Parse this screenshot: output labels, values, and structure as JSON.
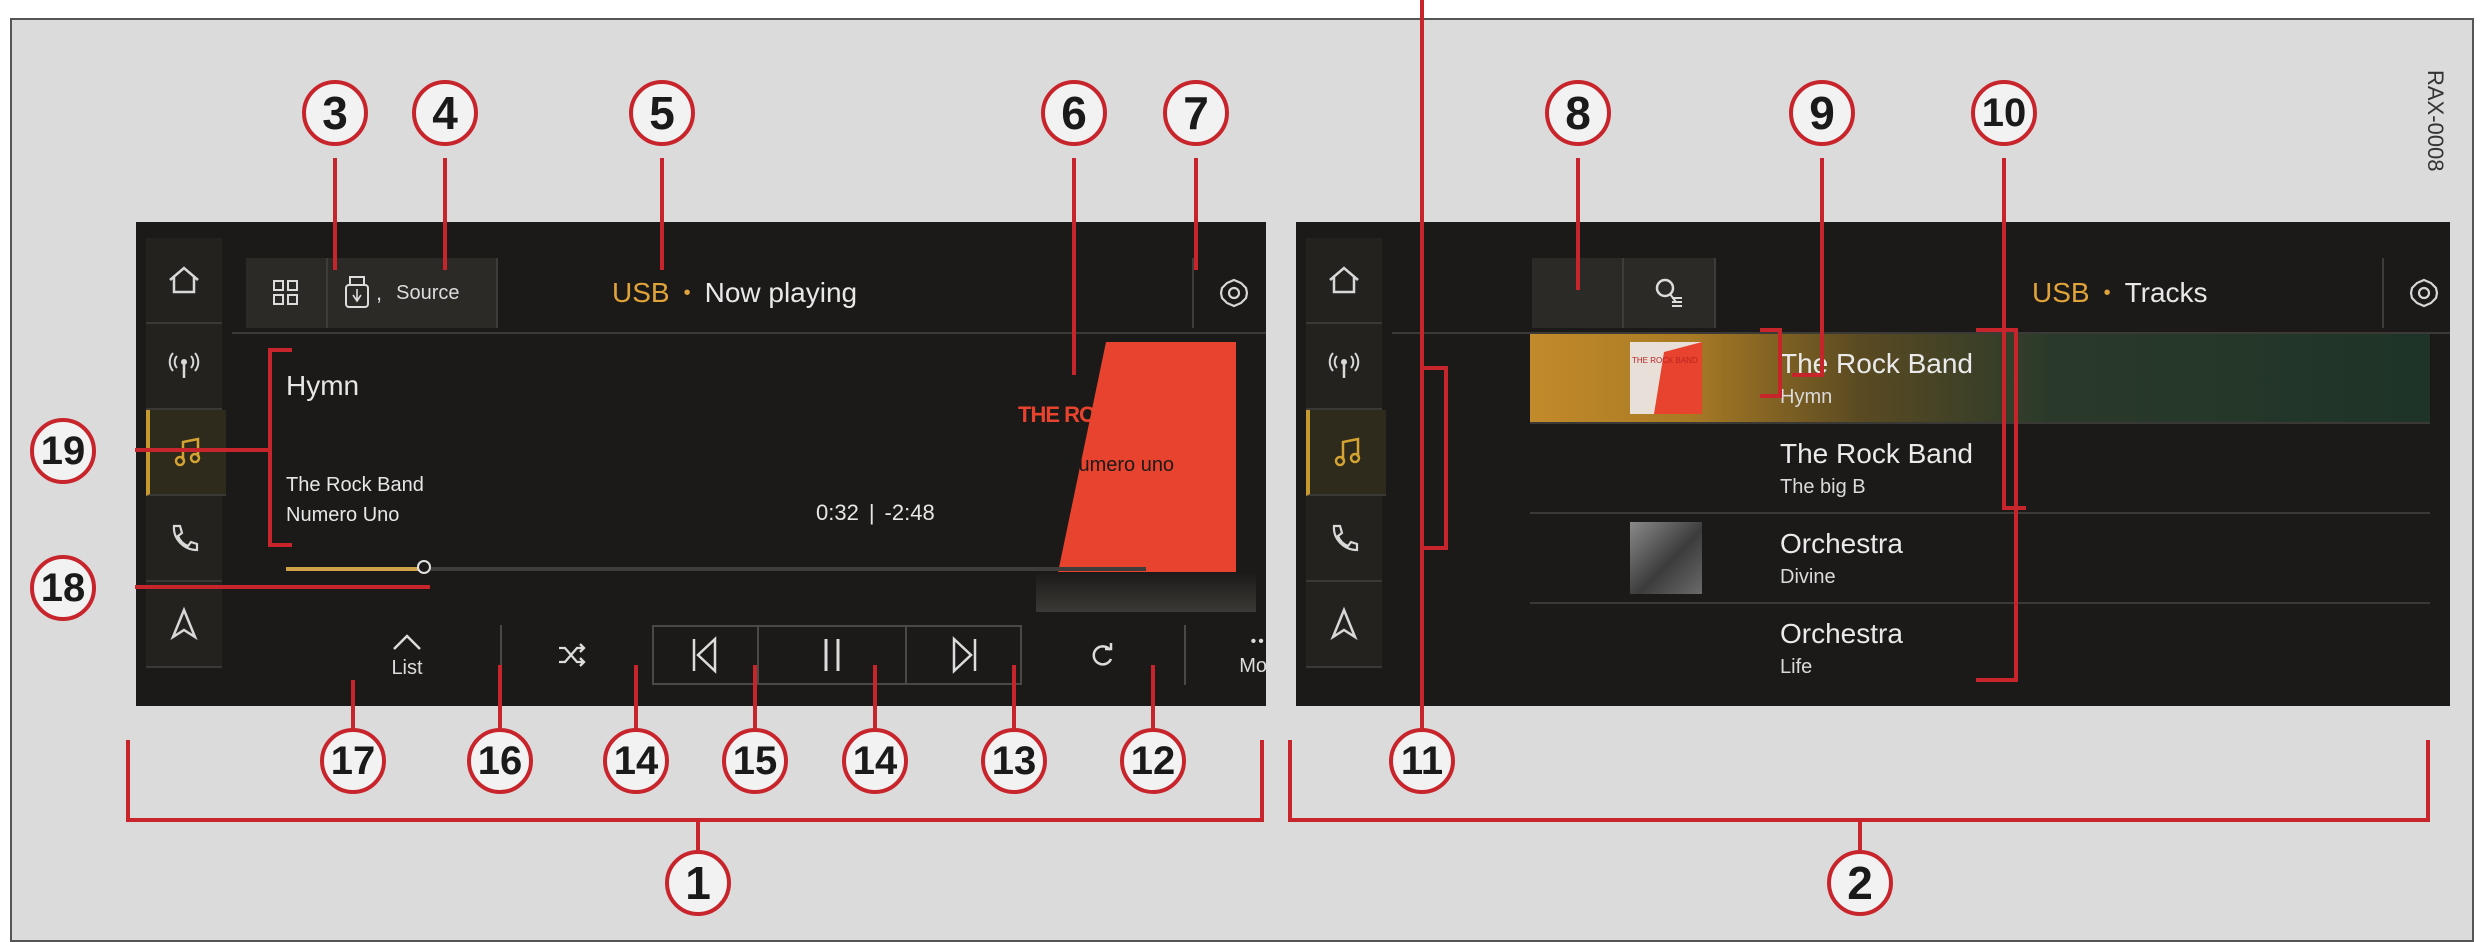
{
  "side_code": "RAX-0008",
  "left_screen": {
    "tiles": {
      "source_label": "Source"
    },
    "header": {
      "source": "USB",
      "separator": "•",
      "title": "Now playing"
    },
    "track": {
      "title": "Hymn",
      "artist": "The Rock Band",
      "album": "Numero Uno"
    },
    "time": {
      "elapsed": "0:32",
      "divider": "|",
      "remaining": "-2:48"
    },
    "cover": {
      "band_text": "THE ROCK BAND",
      "album_text": "Numero uno"
    },
    "progress_fraction": 0.16,
    "controls": {
      "list_label": "List",
      "more_label": "More",
      "more_glyph": "•••"
    }
  },
  "right_screen": {
    "header": {
      "source": "USB",
      "separator": "•",
      "title": "Tracks"
    },
    "list": [
      {
        "title": "The Rock Band",
        "subtitle": "Hymn",
        "selected": true
      },
      {
        "title": "The Rock Band",
        "subtitle": "The big B",
        "selected": false
      },
      {
        "title": "Orchestra",
        "subtitle": "Divine",
        "selected": false
      },
      {
        "title": "Orchestra",
        "subtitle": "Life",
        "selected": false
      }
    ],
    "thumb_text": "THE ROCK BAND"
  },
  "callouts": {
    "c1": "1",
    "c2": "2",
    "c3": "3",
    "c4": "4",
    "c5": "5",
    "c6": "6",
    "c7": "7",
    "c8": "8",
    "c9": "9",
    "c10": "10",
    "c11": "11",
    "c12": "12",
    "c13": "13",
    "c14a": "14",
    "c14b": "14",
    "c15": "15",
    "c16": "16",
    "c17": "17",
    "c18": "18",
    "c19": "19"
  },
  "colors": {
    "accent": "#e0a33a",
    "callout_ring": "#c8242c",
    "cover_red": "#e8432e",
    "screen_bg": "#1b1a18"
  }
}
